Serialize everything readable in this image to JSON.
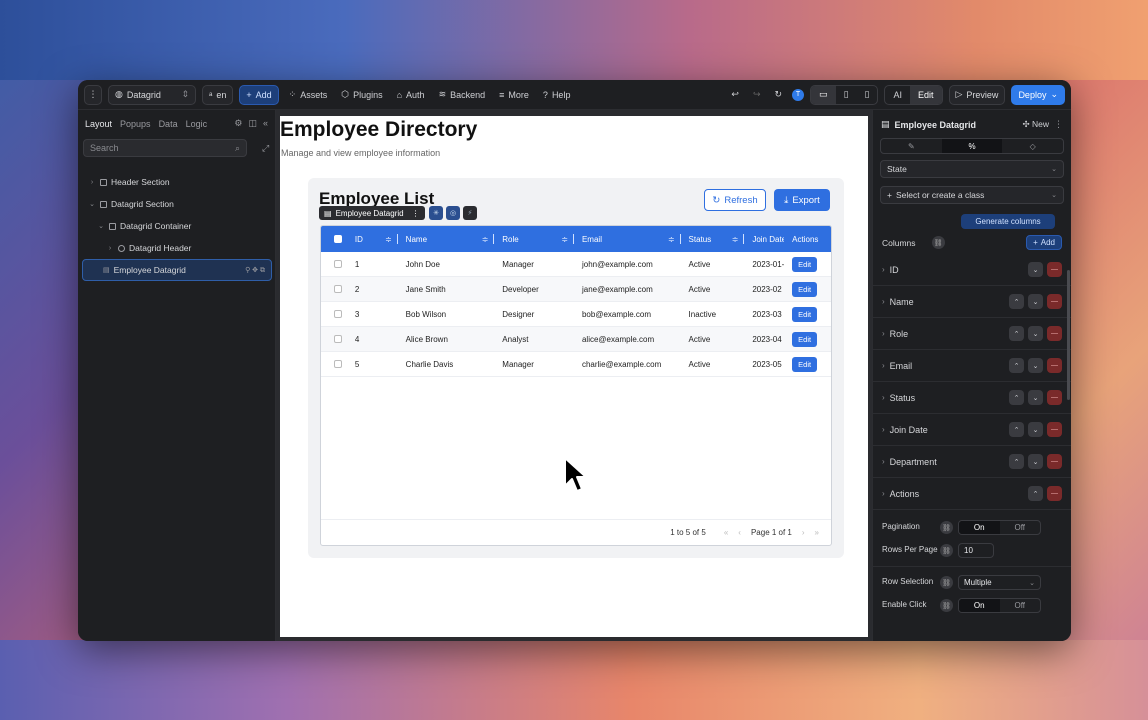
{
  "topbar": {
    "project": "Datagrid",
    "lang": "en",
    "add": "Add",
    "assets": "Assets",
    "plugins": "Plugins",
    "auth": "Auth",
    "backend": "Backend",
    "more": "More",
    "help": "Help",
    "avatar": "T",
    "ai": "AI",
    "edit": "Edit",
    "preview": "Preview",
    "deploy": "Deploy"
  },
  "left": {
    "tabs": [
      "Layout",
      "Popups",
      "Data",
      "Logic"
    ],
    "search_placeholder": "Search",
    "tree": [
      {
        "label": "Header Section"
      },
      {
        "label": "Datagrid Section"
      },
      {
        "label": "Datagrid Container"
      },
      {
        "label": "Datagrid Header"
      },
      {
        "label": "Employee Datagrid"
      }
    ]
  },
  "page": {
    "title": "Employee Directory",
    "subtitle": "Manage and view employee information",
    "card_title": "Employee List",
    "refresh": "Refresh",
    "export": "Export",
    "selected_tag": "Employee Datagrid",
    "columns": [
      "ID",
      "Name",
      "Role",
      "Email",
      "Status",
      "Join Date",
      "Actions"
    ],
    "rows": [
      {
        "id": "1",
        "name": "John Doe",
        "role": "Manager",
        "email": "john@example.com",
        "status": "Active",
        "join": "2023-01-",
        "action": "Edit"
      },
      {
        "id": "2",
        "name": "Jane Smith",
        "role": "Developer",
        "email": "jane@example.com",
        "status": "Active",
        "join": "2023-02",
        "action": "Edit"
      },
      {
        "id": "3",
        "name": "Bob Wilson",
        "role": "Designer",
        "email": "bob@example.com",
        "status": "Inactive",
        "join": "2023-03",
        "action": "Edit"
      },
      {
        "id": "4",
        "name": "Alice Brown",
        "role": "Analyst",
        "email": "alice@example.com",
        "status": "Active",
        "join": "2023-04",
        "action": "Edit"
      },
      {
        "id": "5",
        "name": "Charlie Davis",
        "role": "Manager",
        "email": "charlie@example.com",
        "status": "Active",
        "join": "2023-05",
        "action": "Edit"
      }
    ],
    "footer_count": "1 to 5 of 5",
    "footer_page": "Page 1 of 1"
  },
  "right": {
    "title": "Employee Datagrid",
    "new": "New",
    "state": "State",
    "class_select": "Select or create a class",
    "generate": "Generate columns",
    "columns_label": "Columns",
    "add": "Add",
    "columns": [
      "ID",
      "Name",
      "Role",
      "Email",
      "Status",
      "Join Date",
      "Department",
      "Actions"
    ],
    "pagination_label": "Pagination",
    "on": "On",
    "off": "Off",
    "rows_per_page_label": "Rows Per Page",
    "rows_per_page": "10",
    "row_selection_label": "Row Selection",
    "row_selection": "Multiple",
    "enable_click_label": "Enable Click"
  },
  "colors": {
    "accent": "#2f6fe0",
    "panel": "#1e1f22",
    "danger": "#7a2a2a"
  }
}
